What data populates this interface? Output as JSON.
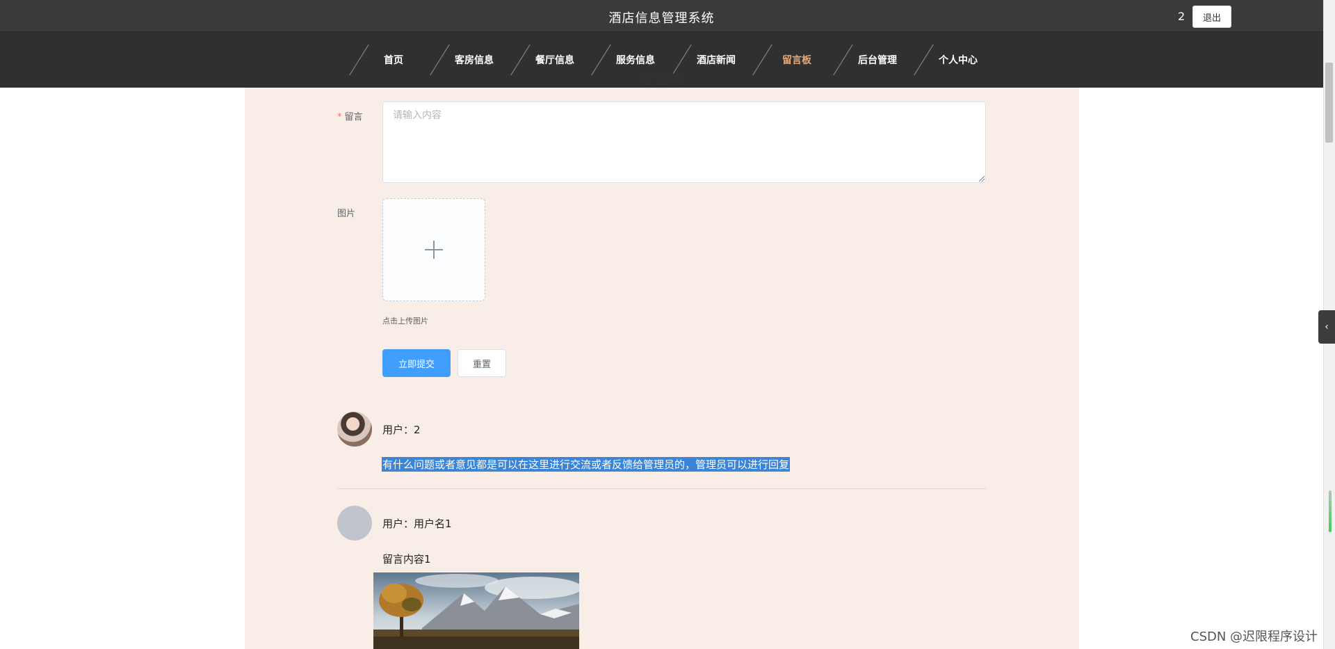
{
  "header": {
    "site_title": "酒店信息管理系统",
    "user_name": "2",
    "logout_label": "退出"
  },
  "nav": {
    "items": [
      {
        "label": "首页",
        "active": false
      },
      {
        "label": "客房信息",
        "active": false
      },
      {
        "label": "餐厅信息",
        "active": false
      },
      {
        "label": "服务信息",
        "active": false
      },
      {
        "label": "酒店新闻",
        "active": false
      },
      {
        "label": "留言板",
        "active": true
      },
      {
        "label": "后台管理",
        "active": false
      },
      {
        "label": "个人中心",
        "active": false
      }
    ]
  },
  "page": {
    "heading": "留言板"
  },
  "form": {
    "message_label": "留言",
    "required_mark": "*",
    "message_placeholder": "请输入内容",
    "image_label": "图片",
    "upload_hint": "点击上传图片",
    "submit_label": "立即提交",
    "reset_label": "重置"
  },
  "comments": [
    {
      "user": "用户：2",
      "content": "有什么问题或者意见都是可以在这里进行交流或者反馈给管理员的，管理员可以进行回复",
      "selected": true,
      "avatar": "photo"
    },
    {
      "user": "用户：用户名1",
      "content": "留言内容1",
      "selected": false,
      "avatar": "default",
      "has_image": true
    }
  ],
  "side_tab": {
    "icon": "chevron-left-icon",
    "glyph": "‹"
  },
  "watermark": "CSDN @迟限程序设计",
  "colors": {
    "header_bg": "#3a3a3a",
    "nav_bg": "#303030",
    "active_nav": "#e7a978",
    "panel_bg": "#f9eee7",
    "primary": "#409eff",
    "selection": "#3b84d6"
  }
}
